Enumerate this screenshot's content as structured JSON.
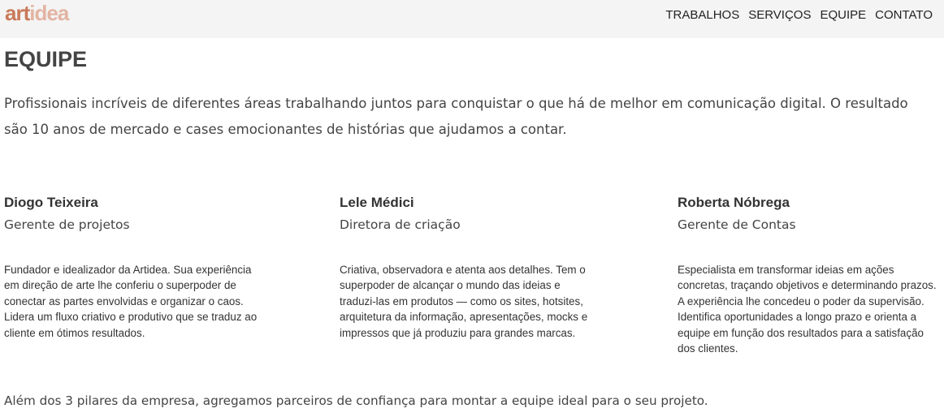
{
  "brand": {
    "logo_part1": "art",
    "logo_part2": "idea"
  },
  "nav": {
    "items": [
      "TRABALHOS",
      "SERVIÇOS",
      "EQUIPE",
      "CONTATO"
    ]
  },
  "page": {
    "title": "EQUIPE",
    "intro": "Profissionais incríveis de diferentes áreas trabalhando juntos para conquistar o que há de melhor em comunicação digital. O resultado são 10 anos de mercado e cases emocionantes de histórias que ajudamos a contar.",
    "footer": "Além dos 3 pilares da empresa, agregamos parceiros de confiança para montar a equipe ideal para o seu projeto."
  },
  "team": [
    {
      "name": "Diogo Teixeira",
      "role": "Gerente de projetos",
      "bio": "Fundador e idealizador da Artidea. Sua experiência em direção de arte lhe conferiu o superpoder de conectar as partes envolvidas e organizar o caos. Lidera um fluxo criativo e produtivo que se traduz ao cliente em ótimos resultados."
    },
    {
      "name": "Lele Médici",
      "role": "Diretora de criação",
      "bio": "Criativa, observadora e atenta aos detalhes. Tem o superpoder de alcançar o mundo das ideias e traduzi-las em produtos — como os sites, hotsites, arquitetura da informação, apresentações, mocks e impressos que já produziu para grandes marcas."
    },
    {
      "name": "Roberta Nóbrega",
      "role": "Gerente de Contas",
      "bio": "Especialista em transformar ideias em ações concretas, traçando objetivos e determinando prazos. A experiência lhe concedeu o poder da supervisão. Identifica oportunidades a longo prazo e orienta a equipe em função dos resultados para a satisfação dos clientes."
    }
  ],
  "colors": {
    "logo_primary": "#c97a5a",
    "logo_secondary": "#e3b4a3",
    "topbar_bg": "#f4f4f4"
  }
}
